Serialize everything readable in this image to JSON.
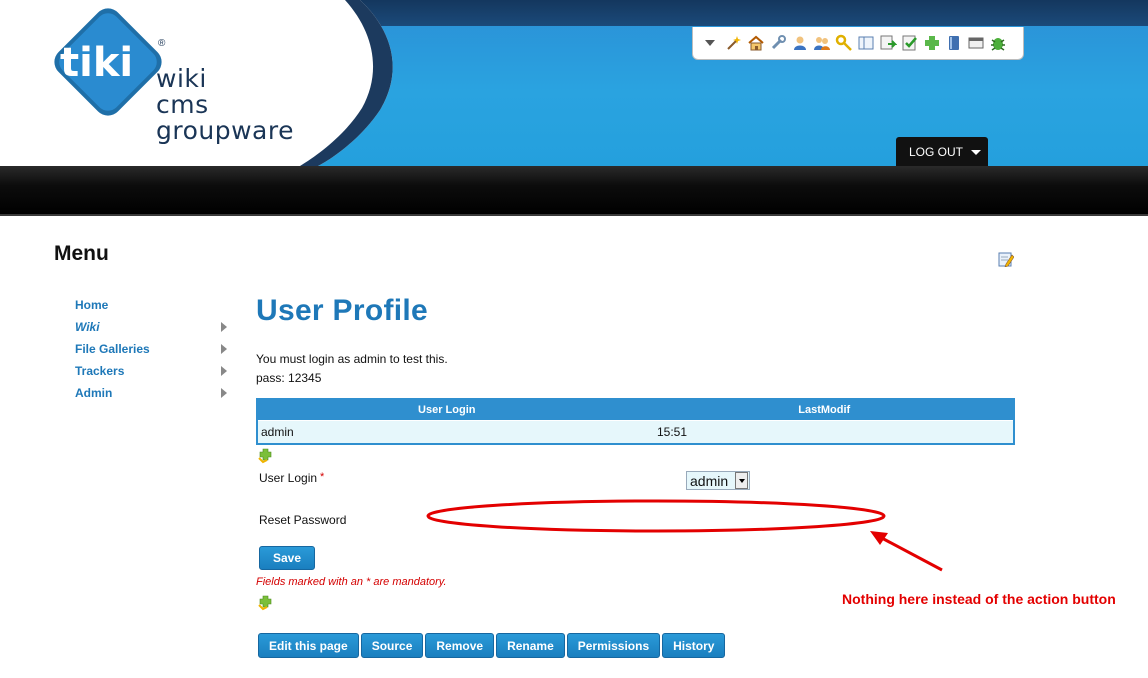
{
  "header": {
    "logo_line1": "wiki",
    "logo_line2": "cms",
    "logo_line3": "groupware",
    "logo_mark": "tiki",
    "registered": "®",
    "logout_label": "LOG OUT",
    "toolbar_icons": [
      "wizard-icon",
      "home-icon",
      "wrench-icon",
      "user-icon",
      "users-icon",
      "key-icon",
      "layout-icon",
      "module-icon",
      "check-icon",
      "plugin-icon",
      "book-icon",
      "window-icon",
      "bug-icon"
    ]
  },
  "sidebar": {
    "title": "Menu",
    "items": [
      {
        "label": "Home"
      },
      {
        "label": "Wiki"
      },
      {
        "label": "File Galleries"
      },
      {
        "label": "Trackers"
      },
      {
        "label": "Admin"
      }
    ]
  },
  "main": {
    "title": "User Profile",
    "note1": "You must login as admin to test this.",
    "note2": "pass: 12345",
    "table": {
      "headers": [
        "User Login",
        "LastModif"
      ],
      "rows": [
        [
          "admin",
          "15:51"
        ]
      ]
    },
    "user_login_label": "User Login",
    "required_mark": "*",
    "user_login_value": "admin",
    "reset_password_label": "Reset Password",
    "save_label": "Save",
    "mandatory_note": "Fields marked with an * are mandatory.",
    "actions": [
      "Edit this page",
      "Source",
      "Remove",
      "Rename",
      "Permissions",
      "History"
    ]
  },
  "annotation": {
    "text": "Nothing here instead of the action button",
    "color": "#e30000"
  },
  "colors": {
    "accent": "#1e78b8",
    "header_blue": "#2aa3e0",
    "table_head": "#2f8fcf"
  }
}
